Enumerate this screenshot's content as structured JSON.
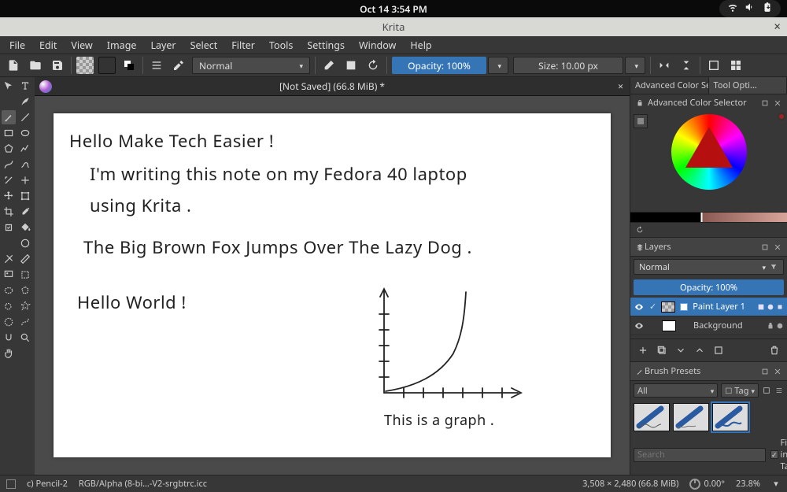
{
  "os_bar": {
    "clock": "Oct 14   3:54 PM"
  },
  "window": {
    "title": "Krita"
  },
  "menu": [
    "File",
    "Edit",
    "View",
    "Image",
    "Layer",
    "Select",
    "Filter",
    "Tools",
    "Settings",
    "Window",
    "Help"
  ],
  "toolbar": {
    "blend_mode": "Normal",
    "opacity_label": "Opacity: 100%",
    "size_label": "Size: 10.00 px"
  },
  "canvas_tab": {
    "title": "[Not Saved]  (66.8 MiB) *"
  },
  "canvas_text": {
    "l1": "Hello Make Tech Easier !",
    "l2": "I'm writing this note on my Fedora 40 laptop",
    "l3": "using Krita .",
    "l4": "The Big Brown Fox Jumps Over The Lazy Dog .",
    "l5": "Hello World !",
    "graph_caption": "This is a graph ."
  },
  "right_dock": {
    "tabs": [
      "Advanced Color Selec...",
      "Tool Opti..."
    ],
    "color_head": "Advanced Color Selector",
    "layers_head": "Layers",
    "layer_blend": "Normal",
    "layer_opacity": "Opacity:  100%",
    "layer1": "Paint Layer 1",
    "layer2": "Background",
    "brush_head": "Brush Presets",
    "brush_filter": "All",
    "brush_tag": "Tag",
    "search_placeholder": "Search",
    "filter_tag_label": "Filter in Tag"
  },
  "status": {
    "brush": "c) Pencil-2",
    "profile": "RGB/Alpha (8-bi…-V2-srgbtrc.icc",
    "dims": "3,508 × 2,480 (66.8 MiB)",
    "rotation": "0.00°",
    "zoom": "23.8%"
  }
}
